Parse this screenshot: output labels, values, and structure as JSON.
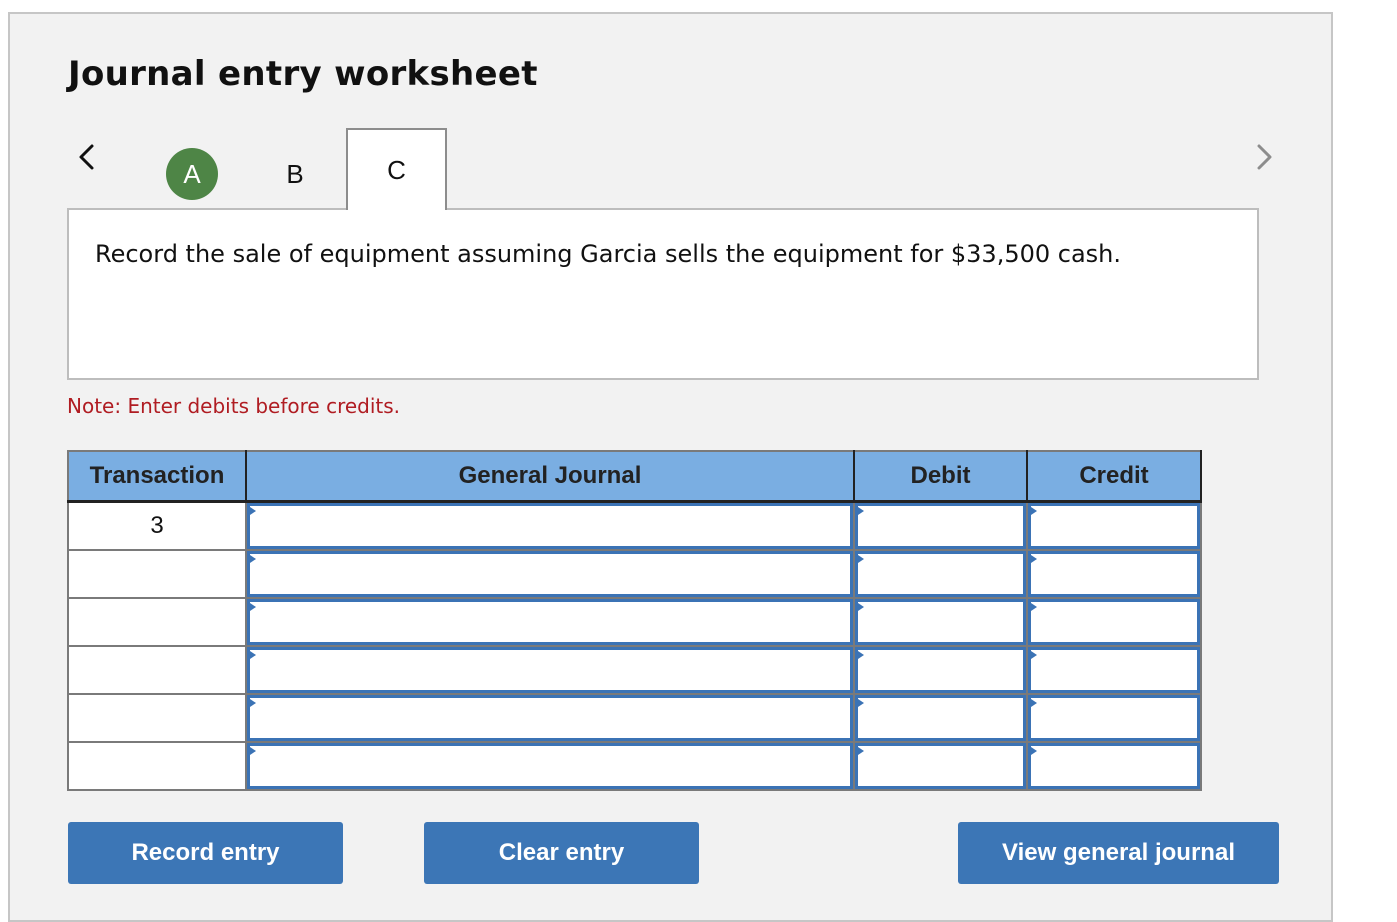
{
  "worksheet": {
    "title": "Journal entry worksheet",
    "nav": {
      "prev_icon": "chevron-left-icon",
      "next_icon": "chevron-right-icon"
    },
    "tabs": [
      {
        "label": "A",
        "state": "completed",
        "color": "#4e8546"
      },
      {
        "label": "B",
        "state": "default"
      },
      {
        "label": "C",
        "state": "active"
      }
    ],
    "prompt": "Record the sale of equipment assuming Garcia sells the equipment for $33,500 cash.",
    "note": "Note: Enter debits before credits."
  },
  "table": {
    "headers": {
      "transaction": "Transaction",
      "general_journal": "General Journal",
      "debit": "Debit",
      "credit": "Credit"
    },
    "rows": [
      {
        "transaction": "3",
        "account": "",
        "debit": "",
        "credit": ""
      },
      {
        "transaction": "",
        "account": "",
        "debit": "",
        "credit": ""
      },
      {
        "transaction": "",
        "account": "",
        "debit": "",
        "credit": ""
      },
      {
        "transaction": "",
        "account": "",
        "debit": "",
        "credit": ""
      },
      {
        "transaction": "",
        "account": "",
        "debit": "",
        "credit": ""
      },
      {
        "transaction": "",
        "account": "",
        "debit": "",
        "credit": ""
      }
    ]
  },
  "buttons": {
    "record": "Record entry",
    "clear": "Clear entry",
    "view": "View general journal"
  },
  "colors": {
    "header_bg": "#7aaee2",
    "button_bg": "#3c76b6",
    "note_text": "#b01c22",
    "completed_tab": "#4e8546",
    "input_border": "#3b73b5"
  }
}
